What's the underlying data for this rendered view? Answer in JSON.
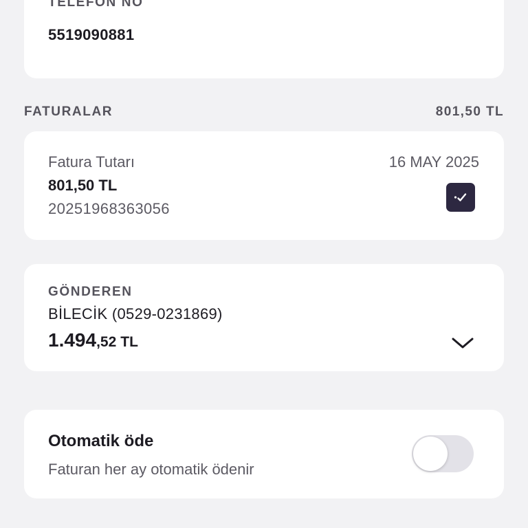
{
  "phone": {
    "label": "TELEFON NO",
    "value": "5519090881"
  },
  "invoices": {
    "title": "FATURALAR",
    "total": "801,50 TL",
    "items": [
      {
        "label": "Fatura Tutarı",
        "amount": "801,50 TL",
        "number": "20251968363056",
        "date": "16 MAY 2025",
        "selected": true,
        "icon": "check-icon"
      }
    ]
  },
  "sender": {
    "label": "GÖNDEREN",
    "name": "BİLECİK (0529-0231869)",
    "balance_int": "1.494",
    "balance_dec": ",52",
    "balance_currency": "TL",
    "icon": "chevron-down-icon"
  },
  "autopay": {
    "title": "Otomatik öde",
    "subtitle": "Faturan her ay otomatik ödenir",
    "enabled": false
  },
  "colors": {
    "background": "#f2f2f4",
    "card": "#ffffff",
    "accent": "#2d2841",
    "text_primary": "#1d1b22",
    "text_secondary": "#5c5a63",
    "toggle_off": "#e3e2e8"
  }
}
